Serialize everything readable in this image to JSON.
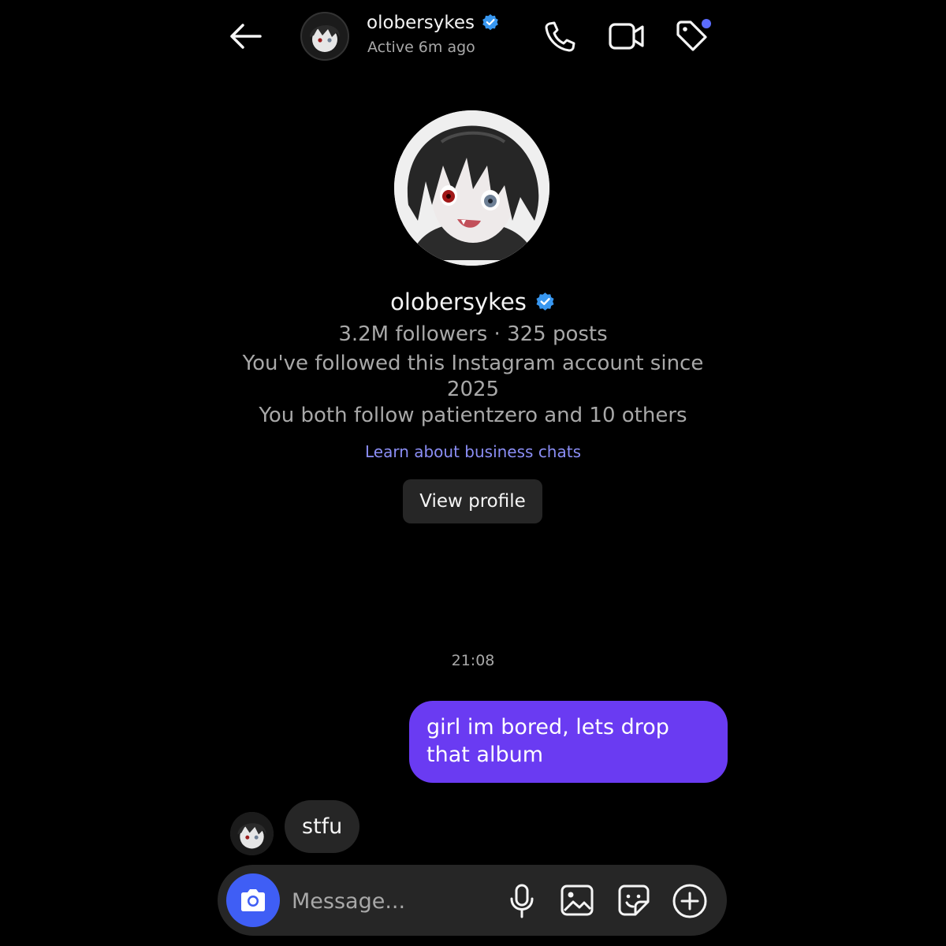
{
  "header": {
    "username": "olobersykes",
    "status": "Active 6m ago",
    "verified_color": "#3897f0",
    "icons": [
      "back-arrow-icon",
      "phone-icon",
      "video-camera-icon",
      "tag-icon"
    ],
    "tag_dot_color": "#5b6cff"
  },
  "profile": {
    "username": "olobersykes",
    "stats": "3.2M followers · 325 posts",
    "followed_since": "You've followed this Instagram account since 2025",
    "mutuals": "You both follow patientzero and 10 others",
    "learn_link": "Learn about business chats",
    "view_profile_label": "View profile"
  },
  "conversation": {
    "timestamp": "21:08",
    "messages": [
      {
        "from": "me",
        "text": "girl im bored, lets drop that album",
        "bubble_color": "#6a3bf2"
      },
      {
        "from": "them",
        "text": "stfu",
        "bubble_color": "#262626"
      }
    ]
  },
  "composer": {
    "placeholder": "Message...",
    "camera_button_color": "#3f5ef5",
    "icons": [
      "camera-icon",
      "microphone-icon",
      "gallery-icon",
      "sticker-icon",
      "plus-icon"
    ]
  }
}
